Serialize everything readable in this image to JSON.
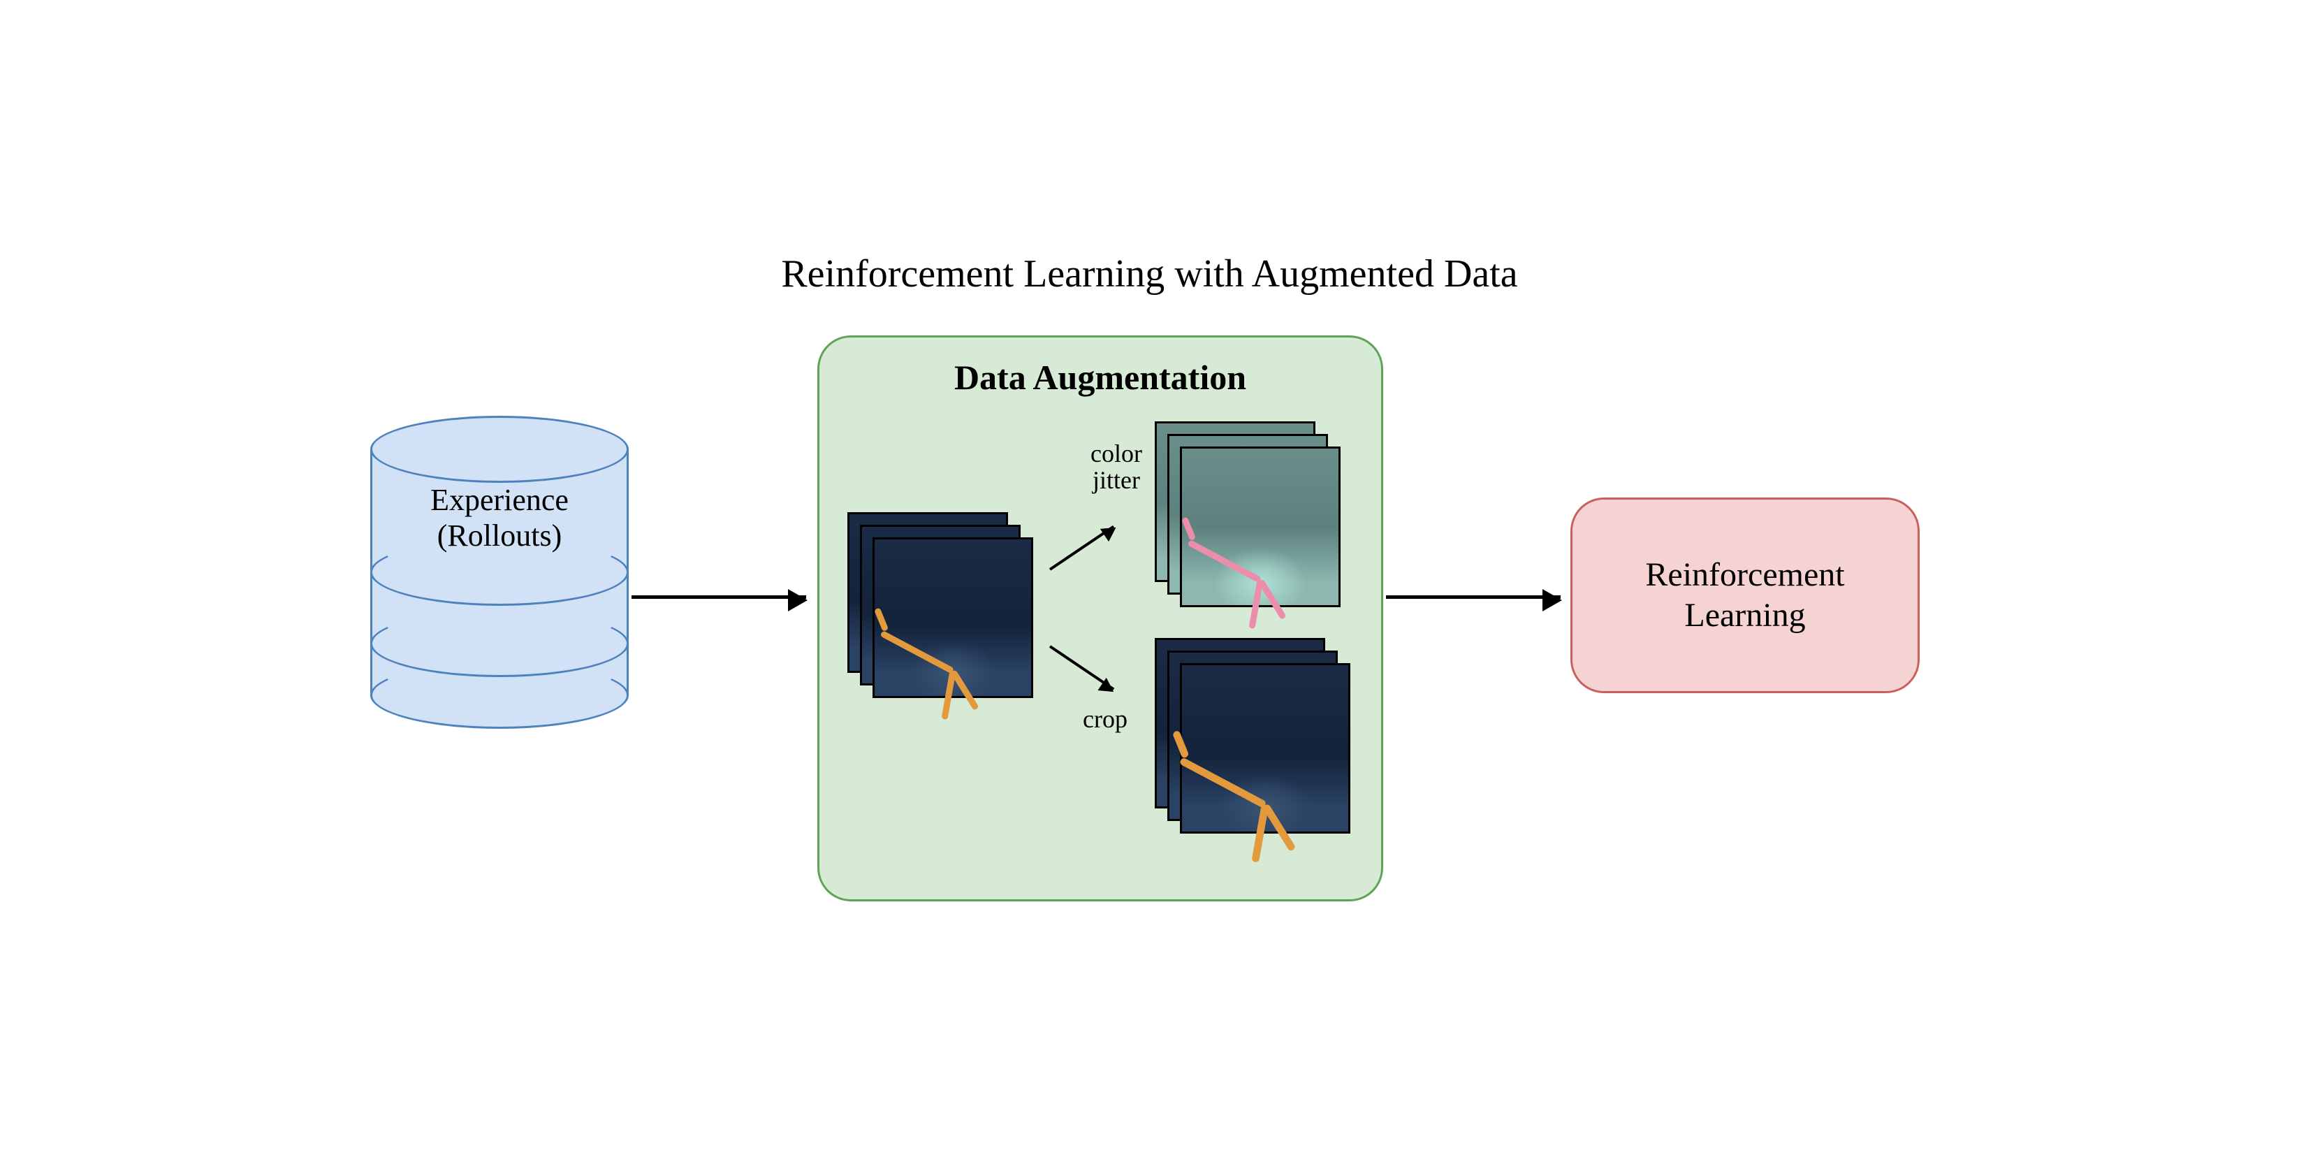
{
  "title": "Reinforcement Learning with Augmented Data",
  "experience": {
    "line1": "Experience",
    "line2": "(Rollouts)"
  },
  "augmentation": {
    "title": "Data Augmentation",
    "color_jitter_label": "color\njitter",
    "crop_label": "crop"
  },
  "rl": {
    "line1": "Reinforcement",
    "line2": "Learning"
  },
  "colors": {
    "cylinder_fill": "#d2e2f6",
    "cylinder_stroke": "#4e82bd",
    "aug_fill": "#d6ead5",
    "aug_stroke": "#5fa456",
    "rl_fill": "#f4d3d2",
    "rl_stroke": "#c9605d",
    "walker_orange": "#e29a3d",
    "walker_pink": "#ec8dac"
  }
}
